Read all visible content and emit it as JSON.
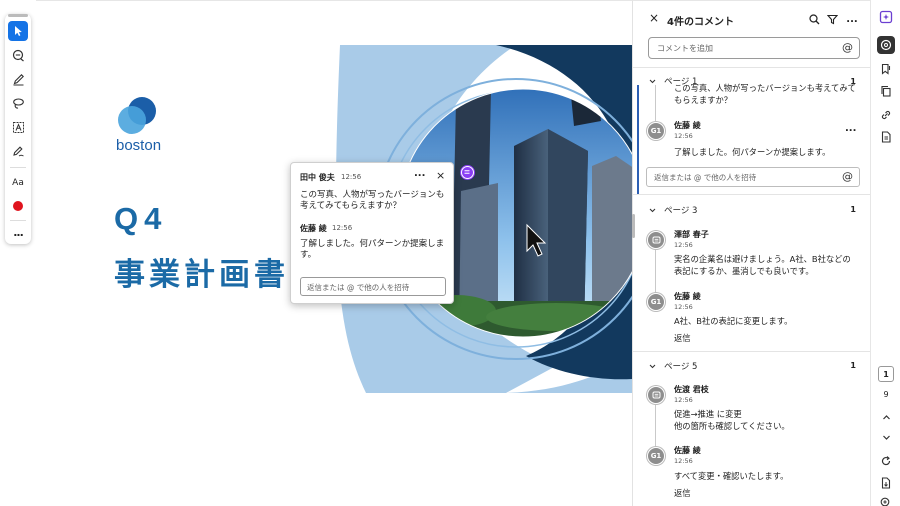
{
  "toolbar": {
    "tools": [
      "select-tool",
      "add-comment-tool",
      "draw-tool",
      "lasso-tool",
      "text-box-tool",
      "fill-sign-tool",
      "text-format-tool",
      "color-picker",
      "more-tools"
    ],
    "text_tool_label": "Aa",
    "color": "#e0141e",
    "more_label": "..."
  },
  "slide": {
    "logo_text": "boston",
    "title_line1": "Q4",
    "title_line2": "事業計画書",
    "brand_color": "#1b6aa6"
  },
  "popup": {
    "author": "田中 俊夫",
    "time": "12:56",
    "text": "この写真、人物が写ったバージョンも考えてみてもらえますか？",
    "reply_author": "佐藤 綾",
    "reply_time": "12:56",
    "reply_text": "了解しました。何パターンか提案しま す。",
    "reply_placeholder": "返信または @ で他の人を招待",
    "more_label": "...",
    "close_label": "×"
  },
  "panel": {
    "close_label": "×",
    "title": "4件のコメント",
    "more_label": "...",
    "add_placeholder": "コメントを追加",
    "at_symbol": "@",
    "groups": [
      {
        "page": "ページ 1",
        "count": "1",
        "root_text": "この写真、人物が写ったバージョンも考えてみてもらえますか？",
        "reply_avatar": "G1",
        "reply_author": "佐藤 綾",
        "reply_time": "12:56",
        "reply_text": "了解しました。何パターンか提案します。",
        "more_label": "...",
        "reply_placeholder": "返信または @ で他の人を招待"
      },
      {
        "page": "ページ 3",
        "count": "1",
        "author": "澤部 春子",
        "time": "12:56",
        "text": "実名の企業名は避けましょう。A社、B社などの表記にするか、墨消しでも良いです。",
        "reply_avatar": "G1",
        "reply_author": "佐藤 綾",
        "reply_time": "12:56",
        "reply_text": "A社、B社の表記に変更します。",
        "reply_link": "返信"
      },
      {
        "page": "ページ 5",
        "count": "1",
        "author": "佐渡 君枝",
        "time": "12:56",
        "text_line1": "促進→推進 に変更",
        "text_line2": "他の箇所も確認してください。",
        "reply_avatar": "G1",
        "reply_author": "佐藤 綾",
        "reply_time": "12:56",
        "reply_text": "すべて変更・確認いたします。",
        "reply_link": "返信"
      }
    ]
  },
  "rail": {
    "current_page": "1",
    "total_pages": "9"
  }
}
